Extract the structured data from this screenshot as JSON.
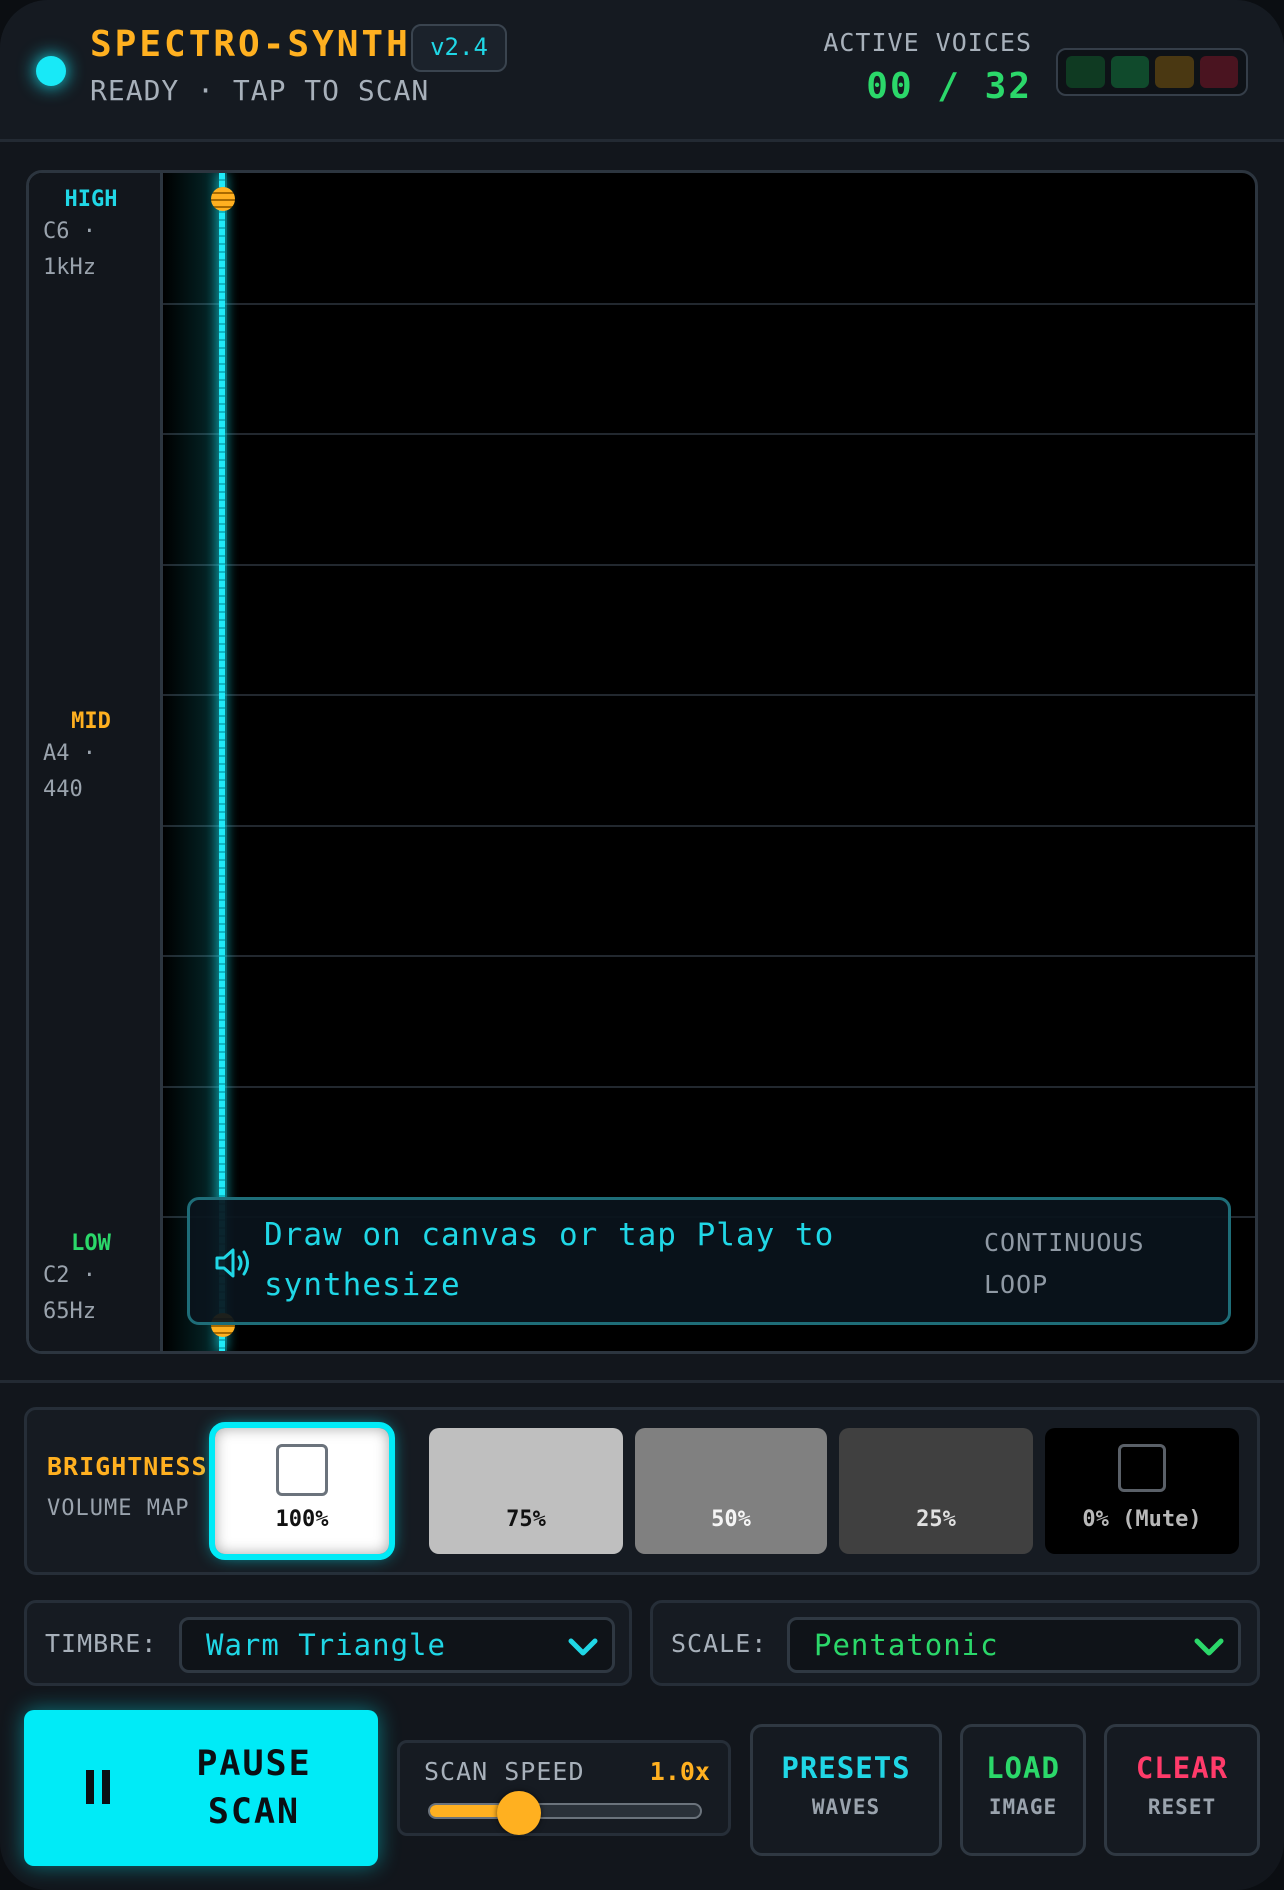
{
  "header": {
    "app_title": "SPECTRO-SYNTH",
    "version": "v2.4",
    "status": "READY · TAP TO SCAN",
    "voices_label": "ACTIVE VOICES",
    "voices_count": "00 / 32",
    "meter_colors": [
      "#0f3a22",
      "#104a2c",
      "#4a3812",
      "#4a1420"
    ]
  },
  "canvas": {
    "axis": {
      "high": {
        "tag": "HIGH",
        "note_line1": "C6 ·",
        "note_line2": "1kHz",
        "color": "#20d7e6"
      },
      "mid": {
        "tag": "MID",
        "note_line1": "A4 ·",
        "note_line2": "440",
        "color": "#ffb020"
      },
      "low": {
        "tag": "LOW",
        "note_line1": "C2 ·",
        "note_line2": "65Hz",
        "color": "#2bd86a"
      }
    },
    "hint": {
      "icon": "speaker-icon",
      "text": "Draw on canvas or tap Play to synthesize",
      "mode_line1": "CONTINUOUS",
      "mode_line2": "LOOP"
    }
  },
  "brightness": {
    "title": "BRIGHTNESS",
    "subtitle": "VOLUME MAP",
    "swatches": [
      {
        "label": "100%",
        "bg": "#ffffff",
        "fg": "#111111",
        "selected": true
      },
      {
        "label": "75%",
        "bg": "#bfbfbf",
        "fg": "#111111",
        "selected": false
      },
      {
        "label": "50%",
        "bg": "#808080",
        "fg": "#f5f5f5",
        "selected": false
      },
      {
        "label": "25%",
        "bg": "#404040",
        "fg": "#e0e0e0",
        "selected": false
      },
      {
        "label": "0% (Mute)",
        "bg": "#000000",
        "fg": "#b8b8b8",
        "selected": false
      }
    ]
  },
  "timbre": {
    "label": "TIMBRE:",
    "value": "Warm Triangle",
    "color": "#20d7e6"
  },
  "scale": {
    "label": "SCALE:",
    "value": "Pentatonic",
    "color": "#2bd86a"
  },
  "transport": {
    "pause_line1": "PAUSE",
    "pause_line2": "SCAN",
    "speed_label": "SCAN SPEED",
    "speed_value": "1.0x",
    "speed_level": 0.33
  },
  "actions": {
    "presets": {
      "title": "PRESETS",
      "sub": "WAVES",
      "color": "#20d7e6"
    },
    "load": {
      "title": "LOAD",
      "sub": "IMAGE",
      "color": "#2bd86a"
    },
    "clear": {
      "title": "CLEAR",
      "sub": "RESET",
      "color": "#ff3b6a"
    }
  }
}
